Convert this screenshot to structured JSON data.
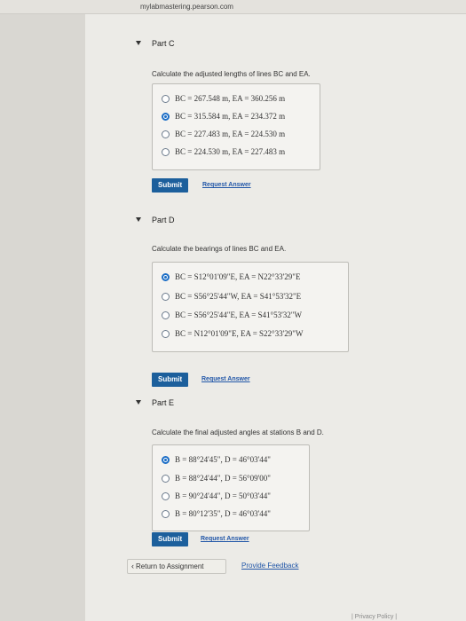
{
  "browser": {
    "url": "mylabmastering.pearson.com"
  },
  "parts": [
    {
      "title": "Part C",
      "question": "Calculate the adjusted lengths of lines BC and EA.",
      "choices": [
        {
          "label": "BC = 267.548 m, EA = 360.256 m",
          "selected": false
        },
        {
          "label": "BC = 315.584 m, EA = 234.372 m",
          "selected": true
        },
        {
          "label": "BC = 227.483 m, EA = 224.530 m",
          "selected": false
        },
        {
          "label": "BC = 224.530 m, EA = 227.483 m",
          "selected": false
        }
      ],
      "submit_label": "Submit",
      "request_label": "Request Answer"
    },
    {
      "title": "Part D",
      "question": "Calculate the bearings of lines BC and EA.",
      "choices": [
        {
          "label": "BC = S12°01'09\"E, EA = N22°33'29\"E",
          "selected": true
        },
        {
          "label": "BC = S56°25'44\"W, EA = S41°53'32\"E",
          "selected": false
        },
        {
          "label": "BC = S56°25'44\"E, EA = S41°53'32\"W",
          "selected": false
        },
        {
          "label": "BC = N12°01'09\"E, EA = S22°33'29\"W",
          "selected": false
        }
      ],
      "submit_label": "Submit",
      "request_label": "Request Answer"
    },
    {
      "title": "Part E",
      "question": "Calculate the final adjusted angles at stations B and D.",
      "choices": [
        {
          "label": "B = 88°24'45\", D = 46°03'44\"",
          "selected": true
        },
        {
          "label": "B = 88°24'44\", D = 56°09'00\"",
          "selected": false
        },
        {
          "label": "B = 90°24'44\", D = 50°03'44\"",
          "selected": false
        },
        {
          "label": "B = 80°12'35\", D = 46°03'44\"",
          "selected": false
        }
      ],
      "submit_label": "Submit",
      "request_label": "Request Answer"
    }
  ],
  "footer": {
    "return_label": "Return to Assignment",
    "feedback_label": "Provide Feedback",
    "bottom_fragment": "| Privacy Policy |"
  }
}
